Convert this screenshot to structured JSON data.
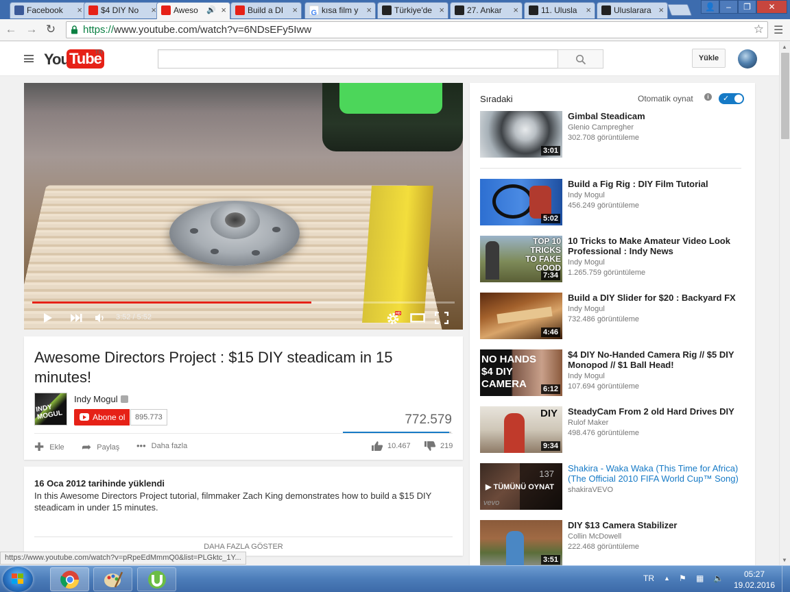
{
  "browser": {
    "tabs": [
      {
        "title": "Facebook",
        "favicon": "facebook-icon",
        "active": false
      },
      {
        "title": "$4 DIY No",
        "favicon": "youtube-icon",
        "active": false
      },
      {
        "title": "Aweso",
        "favicon": "youtube-icon",
        "active": true,
        "audio": true
      },
      {
        "title": "Build a DI",
        "favicon": "youtube-icon",
        "active": false
      },
      {
        "title": "kısa film y",
        "favicon": "google-icon",
        "active": false
      },
      {
        "title": "Türkiye'de",
        "favicon": "kisa-film-icon",
        "active": false
      },
      {
        "title": "27. Ankar",
        "favicon": "kisa-film-icon",
        "active": false
      },
      {
        "title": "11. Ulusla",
        "favicon": "kisa-film-icon",
        "active": false
      },
      {
        "title": "Uluslarara",
        "favicon": "kisa-film-icon",
        "active": false
      }
    ],
    "url_scheme": "https://",
    "url_rest": "www.youtube.com/watch?v=6NDsEFy5Iww",
    "status_url": "https://www.youtube.com/watch?v=pRpeEdMmmQ0&list=PLGktc_1Y..."
  },
  "header": {
    "logo_you": "You",
    "logo_tube": "Tube",
    "logo_region": "TR",
    "upload_label": "Yükle"
  },
  "player": {
    "time_label": "3:52 / 5:52",
    "progress_fraction": 0.66,
    "hd_badge": "HD"
  },
  "video": {
    "title": "Awesome Directors Project : $15 DIY steadicam in 15 minutes!",
    "channel": "Indy Mogul",
    "channel_thumb_text": "INDY MOGUL",
    "subscribe_label": "Abone ol",
    "subscriber_count": "895.773",
    "view_count": "772.579",
    "like_fraction": 0.98,
    "actions": {
      "add": "Ekle",
      "share": "Paylaş",
      "more": "Daha fazla"
    },
    "likes": "10.467",
    "dislikes": "219",
    "published": "16 Oca 2012 tarihinde yüklendi",
    "description": "In this Awesome Directors Project tutorial, filmmaker Zach King demonstrates how to build a $15 DIY steadicam in under 15 minutes.",
    "show_more": "DAHA FAZLA GÖSTER"
  },
  "sidebar": {
    "up_next": "Sıradaki",
    "autoplay": "Otomatik oynat",
    "items": [
      {
        "title": "Gimbal Steadicam",
        "channel": "Glenio Campregher",
        "views": "302.708 görüntüleme",
        "duration": "3:01"
      },
      {
        "title": "Build a Fig Rig : DIY Film Tutorial",
        "channel": "Indy Mogul",
        "views": "456.249 görüntüleme",
        "duration": "5:02"
      },
      {
        "title": "10 Tricks to Make Amateur Video Look Professional : Indy News",
        "channel": "Indy Mogul",
        "views": "1.265.759 görüntüleme",
        "duration": "7:34",
        "thumb_text": "TOP 10 TRICKS TO FAKE GOOD"
      },
      {
        "title": "Build a DIY Slider for $20 : Backyard FX",
        "channel": "Indy Mogul",
        "views": "732.486 görüntüleme",
        "duration": "4:46"
      },
      {
        "title": "$4 DIY No-Handed Camera Rig // $5 DIY Monopod // $1 Ball Head!",
        "channel": "Indy Mogul",
        "views": "107.694 görüntüleme",
        "duration": "6:12",
        "thumb_text": "NO HANDS $4 DIY CAMERA"
      },
      {
        "title": "SteadyCam From 2 old Hard Drives DIY",
        "channel": "Rulof Maker",
        "views": "498.476 görüntüleme",
        "duration": "9:34",
        "thumb_text": "DIY"
      },
      {
        "title": "Shakira - Waka Waka (This Time for Africa) (The Official 2010 FIFA World Cup™ Song)",
        "channel": "shakiraVEVO",
        "playlist_count": "137",
        "playlist_label": "TÜMÜNÜ OYNAT",
        "thumb_text": "vevo"
      },
      {
        "title": "DIY $13 Camera Stabilizer",
        "channel": "Collin McDowell",
        "views": "222.468 görüntüleme",
        "duration": "3:51"
      }
    ]
  },
  "taskbar": {
    "lang": "TR",
    "time": "05:27",
    "date": "19.02.2016"
  },
  "colors": {
    "youtube_red": "#e62117",
    "link_blue": "#167ac6",
    "chrome_frame": "#3d6cae"
  }
}
